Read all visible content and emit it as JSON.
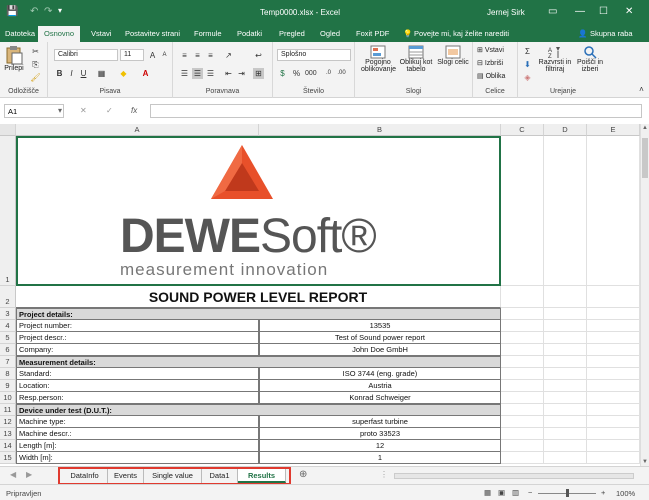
{
  "app": {
    "title": "Temp0000.xlsx - Excel",
    "user": "Jernej Sirk",
    "colors": {
      "accent": "#217346",
      "logo_red": "#e8502a",
      "logo_gray": "#555555",
      "highlight_red": "#e03a2f"
    }
  },
  "ribbon_tabs": [
    "Datoteka",
    "Osnovno",
    "Vstavi",
    "Postavitev strani",
    "Formule",
    "Podatki",
    "Pregled",
    "Ogled",
    "Foxit PDF"
  ],
  "tell_me": "Povejte mi, kaj želite narediti",
  "share": "Skupna raba",
  "ribbon": {
    "paste": "Prilepi",
    "clipboard": "Odložišče",
    "font_name": "Calibri",
    "font_size": "11",
    "font_group": "Pisava",
    "align_group": "Poravnava",
    "number_format": "Splošno",
    "number_group": "Število",
    "cond_format": "Pogojno oblikovanje",
    "format_table": "Oblikuj kot tabelo",
    "cell_styles": "Slogi celic",
    "styles_group": "Slogi",
    "insert": "Vstavi",
    "delete": "Izbriši",
    "format": "Oblika",
    "cells_group": "Celice",
    "sort_filter": "Razvrsti in filtriraj",
    "find_select": "Poišči in izberi",
    "editing_group": "Urejanje"
  },
  "formula_bar": {
    "name_box": "A1",
    "fx": "fx",
    "value": ""
  },
  "columns": [
    "A",
    "B",
    "C",
    "D",
    "E"
  ],
  "logo": {
    "brand_gray": "DEWE",
    "brand_rest": "Soft®",
    "tagline": "measurement innovation"
  },
  "report_title": "SOUND POWER LEVEL REPORT",
  "rows": [
    {
      "n": "3",
      "type": "section",
      "a": "Project details:",
      "b": ""
    },
    {
      "n": "4",
      "type": "row",
      "a": "Project number:",
      "b": "13535"
    },
    {
      "n": "5",
      "type": "row",
      "a": "Project descr.:",
      "b": "Test of Sound power report"
    },
    {
      "n": "6",
      "type": "row",
      "a": "Company:",
      "b": "John Doe GmbH"
    },
    {
      "n": "7",
      "type": "section",
      "a": "Measurement details:",
      "b": ""
    },
    {
      "n": "8",
      "type": "row",
      "a": "Standard:",
      "b": "ISO 3744 (eng. grade)"
    },
    {
      "n": "9",
      "type": "row",
      "a": "Location:",
      "b": "Austria"
    },
    {
      "n": "10",
      "type": "row",
      "a": "Resp.person:",
      "b": "Konrad Schweiger"
    },
    {
      "n": "11",
      "type": "section",
      "a": "Device under test (D.U.T.):",
      "b": ""
    },
    {
      "n": "12",
      "type": "row",
      "a": "Machine type:",
      "b": "superfast turbine"
    },
    {
      "n": "13",
      "type": "row",
      "a": "Machine descr.:",
      "b": "proto 33523"
    },
    {
      "n": "14",
      "type": "row",
      "a": "Length [m]:",
      "b": "12"
    },
    {
      "n": "15",
      "type": "row",
      "a": "Width [m]:",
      "b": "1"
    }
  ],
  "row_numbers_top": [
    "1",
    "2"
  ],
  "sheets": [
    "DataInfo",
    "Events",
    "Single value",
    "Data1",
    "Results"
  ],
  "active_sheet": "Results",
  "status": {
    "ready": "Pripravljen",
    "zoom": "100%"
  }
}
